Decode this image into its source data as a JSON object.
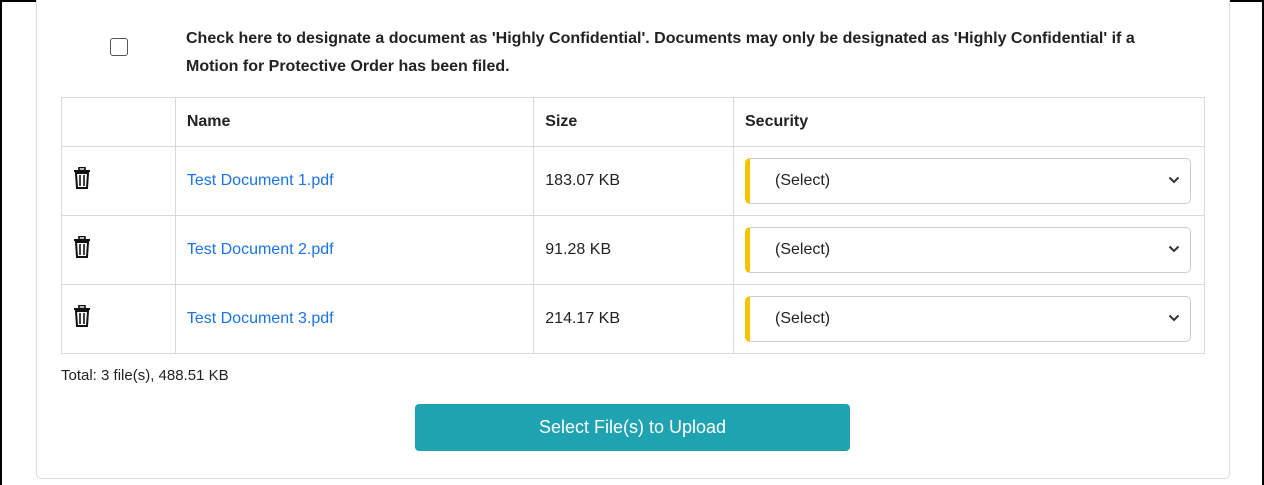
{
  "notice": {
    "text": "Check here to designate a document as 'Highly Confidential'. Documents may only be designated as 'Highly Confidential' if a Motion for Protective Order has been filed.",
    "checked": false
  },
  "table": {
    "headers": {
      "name": "Name",
      "size": "Size",
      "security": "Security"
    },
    "rows": [
      {
        "name": "Test Document 1.pdf",
        "size": "183.07 KB",
        "security": "(Select)"
      },
      {
        "name": "Test Document 2.pdf",
        "size": "91.28 KB",
        "security": "(Select)"
      },
      {
        "name": "Test Document 3.pdf",
        "size": "214.17 KB",
        "security": "(Select)"
      }
    ]
  },
  "total": "Total: 3 file(s), 488.51 KB",
  "upload_button": "Select File(s) to Upload",
  "colors": {
    "link": "#1a73e8",
    "required_accent": "#f5c400",
    "button": "#1fa3b0"
  },
  "icons": {
    "delete": "trash-icon",
    "dropdown": "chevron-down-icon"
  }
}
